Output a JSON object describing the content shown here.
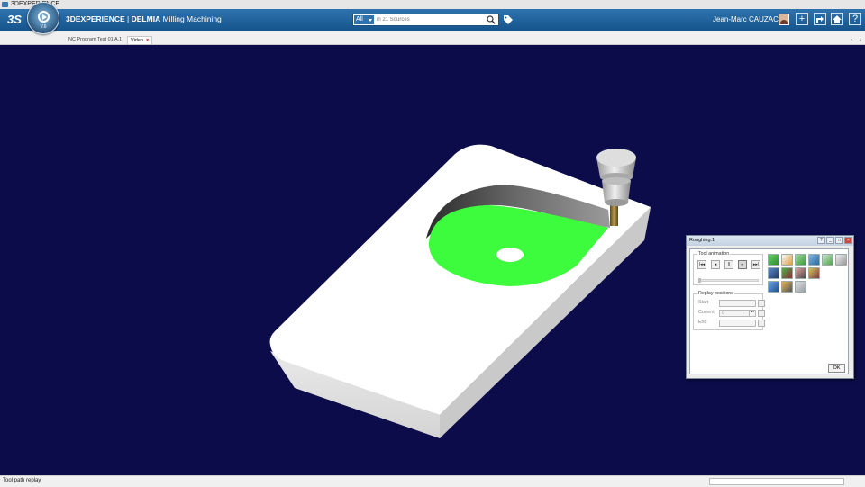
{
  "window": {
    "title": "3DEXPERIENCE"
  },
  "topbar": {
    "brand": "3DEXPERIENCE",
    "product": "DELMIA",
    "app_name": "Milling Machining",
    "compass_version": "V.6",
    "search": {
      "scope": "All",
      "placeholder": "in 21 Sources"
    },
    "user_name": "Jean-Marc CAUZAC",
    "icons": [
      "plus-icon",
      "share-icon",
      "home-icon",
      "help-icon"
    ]
  },
  "tabs": [
    {
      "label": "NC Program Test 01 A.1",
      "active": false
    },
    {
      "label": "Video",
      "active": true
    }
  ],
  "dialog": {
    "title": "Roughing.1",
    "tool_animation": {
      "label": "Tool animation",
      "buttons": [
        "first",
        "step-back",
        "pause",
        "step-forward",
        "last"
      ],
      "active_button": "step-forward"
    },
    "replay_positions": {
      "label": "Replay positions",
      "start_label": "Start",
      "current_label": "Current",
      "current_value": "0",
      "end_label": "End"
    },
    "ok_label": "OK"
  },
  "status": {
    "text": "Tool path replay"
  },
  "colors": {
    "viewport_bg": "#0c0c4a",
    "topbar": "#1f5f97",
    "part": "#ffffff",
    "pocket_floor": "#3dfb3d",
    "tool_holder": "#c9c9c9",
    "tool_shank": "#8a6d2f"
  }
}
